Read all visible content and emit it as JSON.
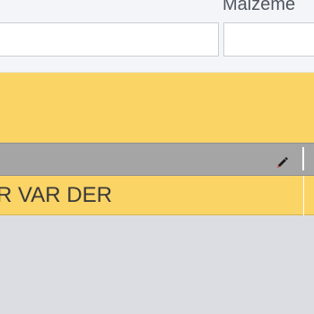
{
  "form": {
    "field_label": "Malzeme",
    "input_left_value": "",
    "input_right_value": ""
  },
  "table": {
    "header": {
      "edit_icon": "pencil-icon"
    },
    "rows": [
      {
        "col1": "R VAR DER"
      }
    ]
  },
  "colors": {
    "highlight": "#fbd466",
    "header": "#a5a5a5",
    "background": "#dcdde2"
  }
}
